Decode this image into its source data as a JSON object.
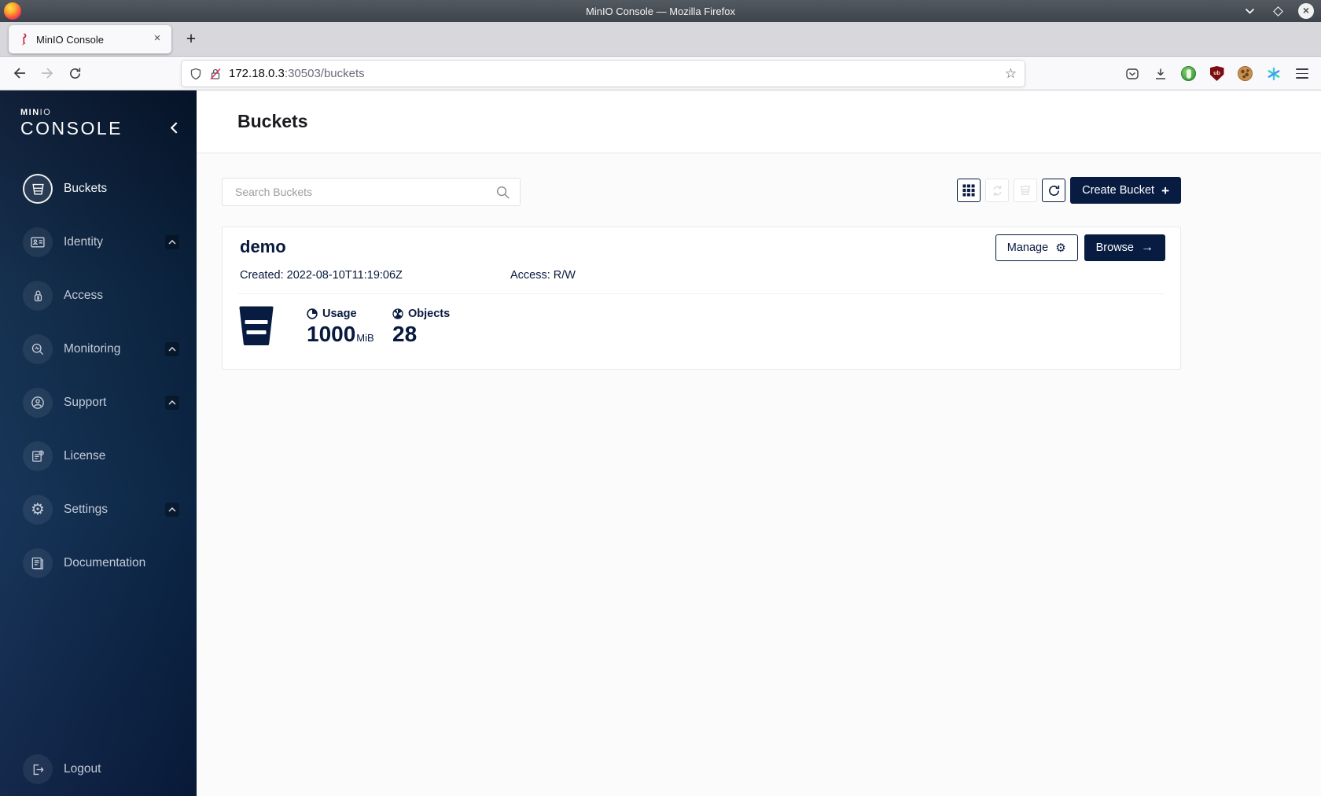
{
  "titlebar": {
    "title": "MinIO Console — Mozilla Firefox",
    "close_glyph": "×"
  },
  "tabbar": {
    "tab_title": "MinIO Console",
    "tab_close_glyph": "×",
    "new_tab_glyph": "+"
  },
  "urlbar": {
    "host": "172.18.0.3",
    "path": ":30503/buckets",
    "star_glyph": "☆"
  },
  "sidebar": {
    "brand_bold": "MIN",
    "brand_light": "IO",
    "brand_sub": "CONSOLE",
    "items": [
      {
        "label": "Buckets",
        "icon": "bucket-icon",
        "active": true
      },
      {
        "label": "Identity",
        "icon": "identity-card-icon",
        "expandable": true
      },
      {
        "label": "Access",
        "icon": "lock-icon"
      },
      {
        "label": "Monitoring",
        "icon": "magnifier-pulse-icon",
        "expandable": true
      },
      {
        "label": "Support",
        "icon": "support-person-icon",
        "expandable": true
      },
      {
        "label": "License",
        "icon": "license-document-icon"
      },
      {
        "label": "Settings",
        "icon": "gear-icon",
        "expandable": true,
        "gear_glyph": "⚙"
      },
      {
        "label": "Documentation",
        "icon": "documentation-book-icon"
      }
    ],
    "logout_label": "Logout"
  },
  "page": {
    "title": "Buckets",
    "search_placeholder": "Search Buckets",
    "create_label": "Create Bucket",
    "create_plus_glyph": "+",
    "bucket": {
      "name": "demo",
      "created": "Created: 2022-08-10T11:19:06Z",
      "access": "Access: R/W",
      "manage_label": "Manage",
      "manage_gear_glyph": "⚙",
      "browse_label": "Browse",
      "browse_arrow_glyph": "→",
      "usage_label": "Usage",
      "usage_value": "1000",
      "usage_unit": "MiB",
      "objects_label": "Objects",
      "objects_value": "28"
    }
  },
  "colors": {
    "minio_navy": "#081C42",
    "minio_red": "#C72C48",
    "content_bg": "#fbfbfb"
  }
}
